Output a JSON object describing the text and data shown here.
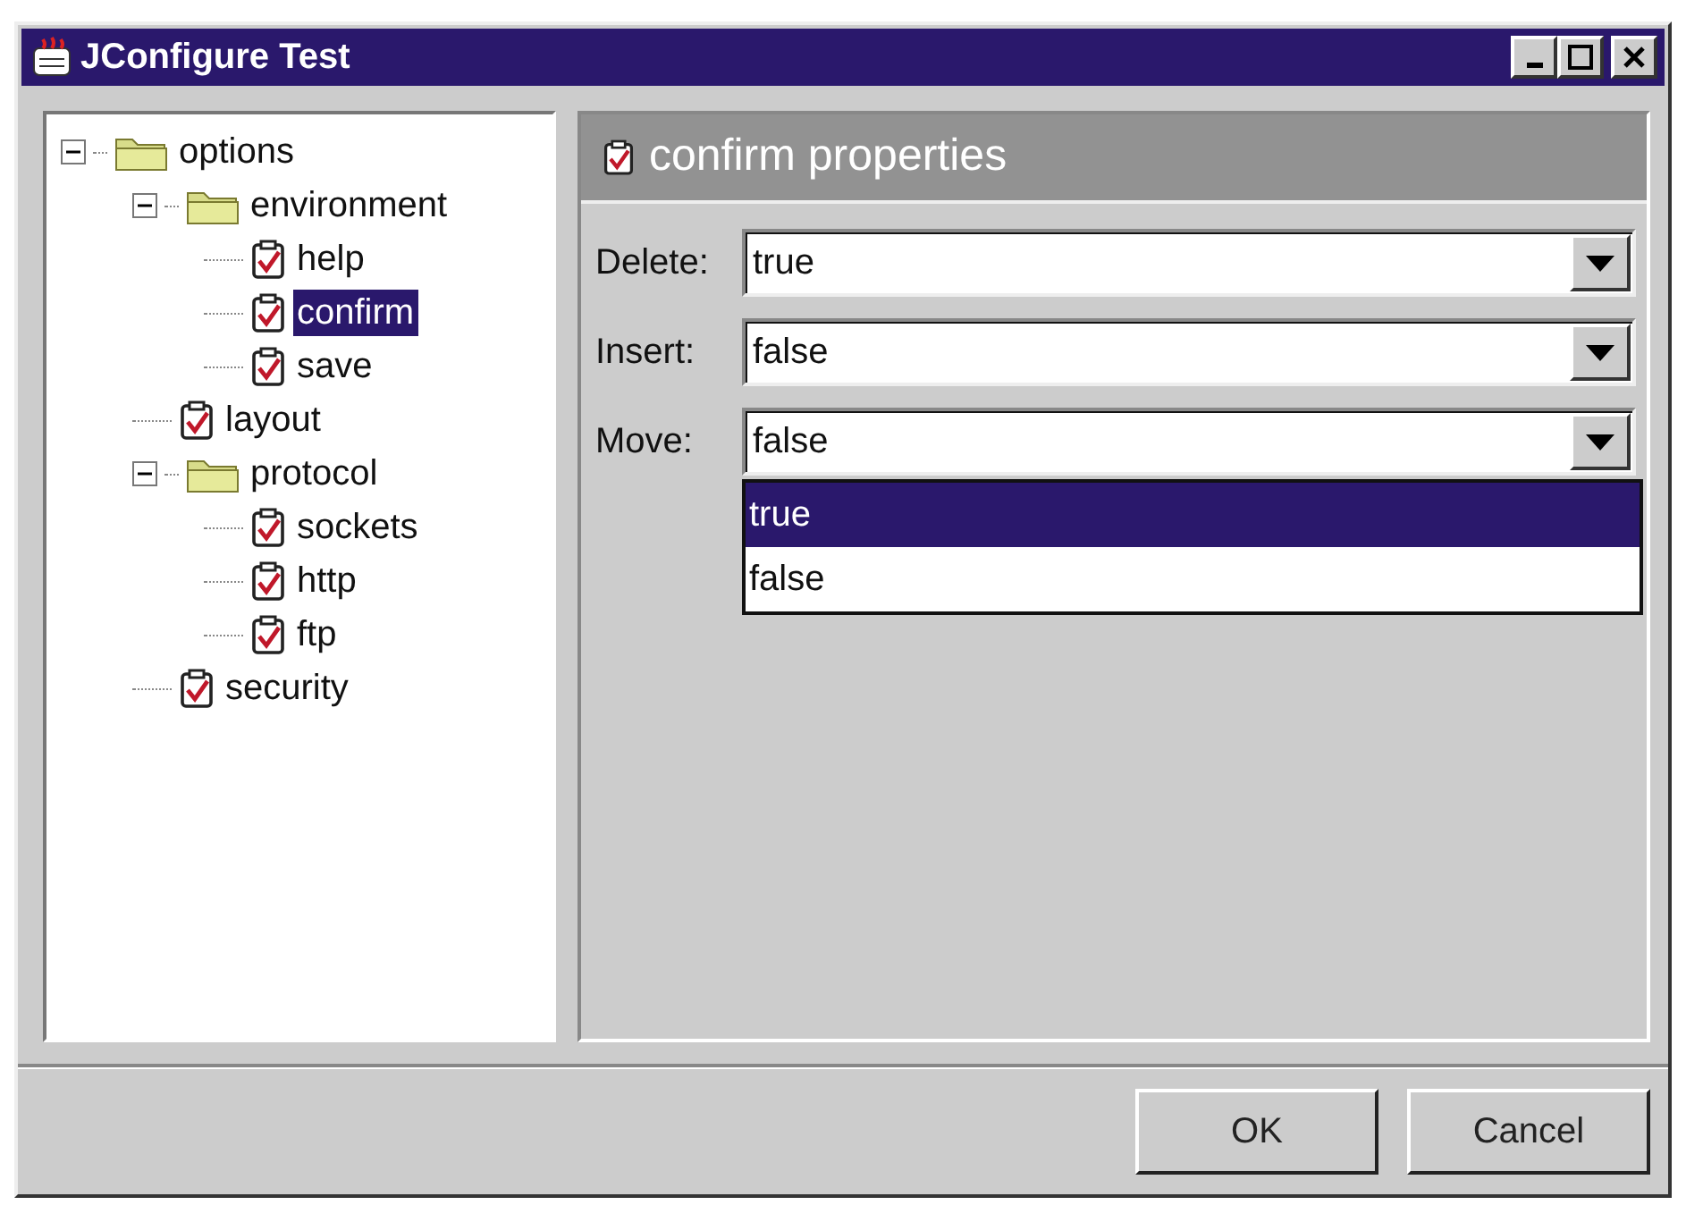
{
  "window": {
    "title": "JConfigure Test"
  },
  "tree": [
    {
      "label": "options",
      "kind": "folder",
      "expanded": true,
      "selected": false,
      "children": [
        {
          "label": "environment",
          "kind": "folder",
          "expanded": true,
          "selected": false,
          "children": [
            {
              "label": "help",
              "kind": "leaf",
              "selected": false
            },
            {
              "label": "confirm",
              "kind": "leaf",
              "selected": true
            },
            {
              "label": "save",
              "kind": "leaf",
              "selected": false
            }
          ]
        },
        {
          "label": "layout",
          "kind": "leaf",
          "selected": false
        },
        {
          "label": "protocol",
          "kind": "folder",
          "expanded": true,
          "selected": false,
          "children": [
            {
              "label": "sockets",
              "kind": "leaf",
              "selected": false
            },
            {
              "label": "http",
              "kind": "leaf",
              "selected": false
            },
            {
              "label": "ftp",
              "kind": "leaf",
              "selected": false
            }
          ]
        },
        {
          "label": "security",
          "kind": "leaf",
          "selected": false
        }
      ]
    }
  ],
  "panel": {
    "title": "confirm properties"
  },
  "fields": [
    {
      "label": "Delete:",
      "value": "true"
    },
    {
      "label": "Insert:",
      "value": "false"
    },
    {
      "label": "Move:",
      "value": "false",
      "options": [
        {
          "label": "true",
          "highlighted": true
        },
        {
          "label": "false",
          "highlighted": false
        }
      ]
    }
  ],
  "buttons": [
    "OK",
    "Cancel"
  ]
}
